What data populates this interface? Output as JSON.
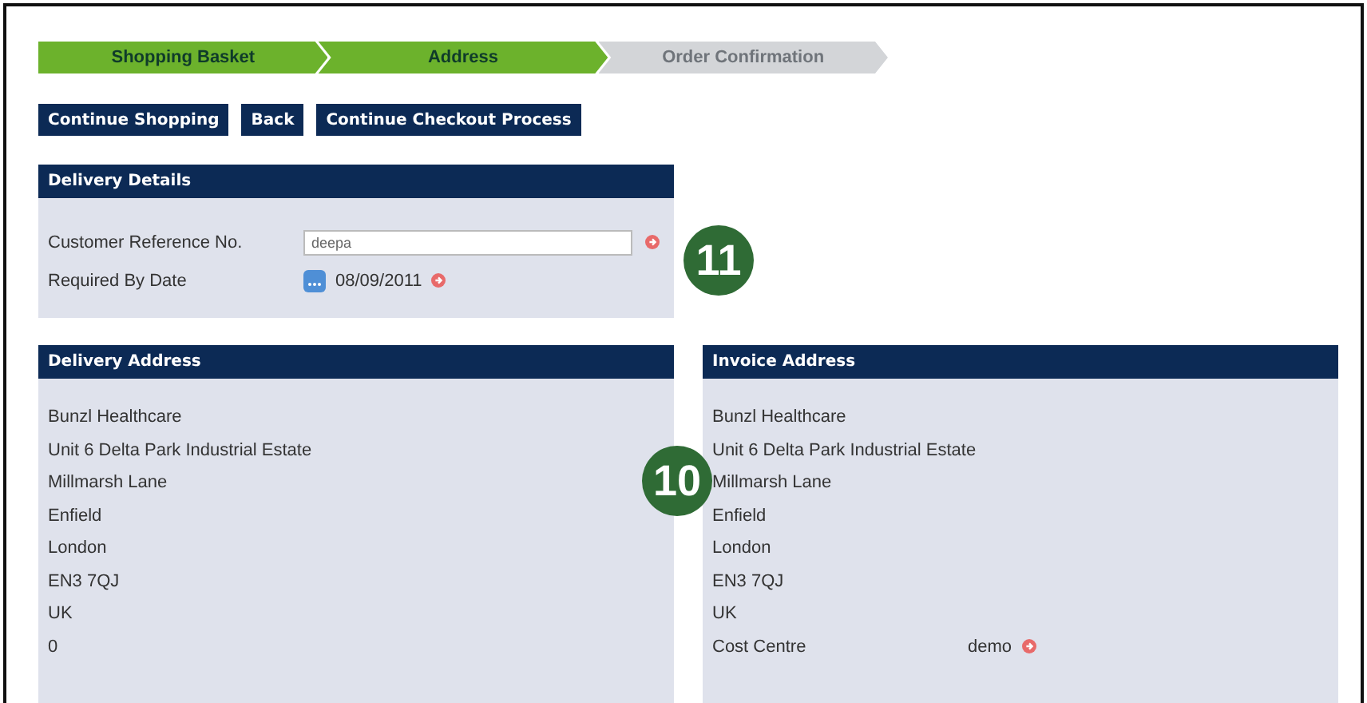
{
  "steps": [
    {
      "label": "Shopping Basket",
      "completed": true
    },
    {
      "label": "Address",
      "completed": true
    },
    {
      "label": "Order Confirmation",
      "completed": false
    }
  ],
  "buttons": [
    "Continue Shopping",
    "Back",
    "Continue Checkout Process"
  ],
  "delivery_details": {
    "title": "Delivery Details",
    "reference": {
      "label": "Customer Reference No.",
      "value": "deepa"
    },
    "required_date": {
      "label": "Required By Date",
      "value": "08/09/2011"
    }
  },
  "callouts": [
    "11",
    "10"
  ],
  "delivery_address": {
    "title": "Delivery Address",
    "lines": [
      "Bunzl Healthcare",
      "Unit 6 Delta Park Industrial Estate",
      "Millmarsh Lane",
      "Enfield",
      "London",
      "EN3 7QJ",
      "UK",
      "0"
    ]
  },
  "invoice_address": {
    "title": "Invoice Address",
    "lines": [
      "Bunzl Healthcare",
      "Unit 6 Delta Park Industrial Estate",
      "Millmarsh Lane",
      "Enfield",
      "London",
      "EN3 7QJ",
      "UK"
    ],
    "cost_centre": {
      "label": "Cost Centre",
      "value": "demo"
    }
  }
}
